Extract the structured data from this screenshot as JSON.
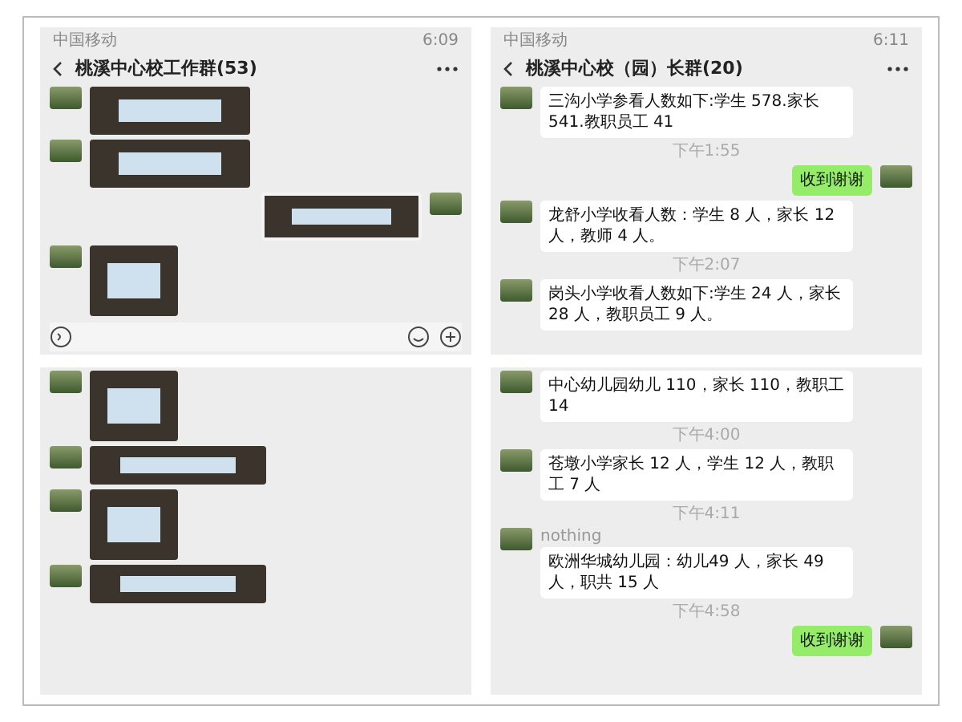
{
  "panels": [
    {
      "status_bar": {
        "carrier": "中国移动",
        "time": "6:09"
      },
      "header": {
        "title": "桃溪中心校工作群(53)"
      },
      "toolbar": true,
      "messages": [
        {
          "kind": "photo",
          "outgoing": false
        },
        {
          "kind": "photo",
          "outgoing": false
        },
        {
          "kind": "photo",
          "outgoing": true
        },
        {
          "kind": "narrow_photo",
          "outgoing": false
        }
      ]
    },
    {
      "status_bar": {
        "carrier": "中国移动",
        "time": "6:11"
      },
      "header": {
        "title": "桃溪中心校（园）长群(20)"
      },
      "messages": [
        {
          "kind": "text",
          "outgoing": false,
          "text": "三沟小学参看人数如下:学生 578.家长 541.教职员工 41"
        },
        {
          "kind": "time",
          "text": "下午1:55"
        },
        {
          "kind": "text",
          "outgoing": true,
          "text": "收到谢谢"
        },
        {
          "kind": "text",
          "outgoing": false,
          "text": "龙舒小学收看人数：学生 8 人，家长 12 人，教师 4 人。"
        },
        {
          "kind": "time",
          "text": "下午2:07"
        },
        {
          "kind": "text",
          "outgoing": false,
          "text": "岗头小学收看人数如下:学生 24 人，家长 28 人，教职员工 9 人。"
        }
      ]
    },
    {
      "messages": [
        {
          "kind": "narrow_photo",
          "outgoing": false
        },
        {
          "kind": "banner_photo",
          "outgoing": false
        },
        {
          "kind": "narrow_photo",
          "outgoing": false
        },
        {
          "kind": "banner_photo",
          "outgoing": false
        }
      ]
    },
    {
      "messages": [
        {
          "kind": "text",
          "outgoing": false,
          "text": "中心幼儿园幼儿 110，家长 110，教职工 14"
        },
        {
          "kind": "time",
          "text": "下午4:00"
        },
        {
          "kind": "text",
          "outgoing": false,
          "text": "苍墩小学家长 12 人，学生 12 人，教职工 7 人"
        },
        {
          "kind": "time",
          "text": "下午4:11"
        },
        {
          "kind": "text",
          "outgoing": false,
          "sender": "nothing",
          "text": "欧洲华城幼儿园：幼儿49 人，家长 49 人，职共 15 人"
        },
        {
          "kind": "time",
          "text": "下午4:58"
        },
        {
          "kind": "text",
          "outgoing": true,
          "text": "收到谢谢"
        }
      ]
    }
  ]
}
